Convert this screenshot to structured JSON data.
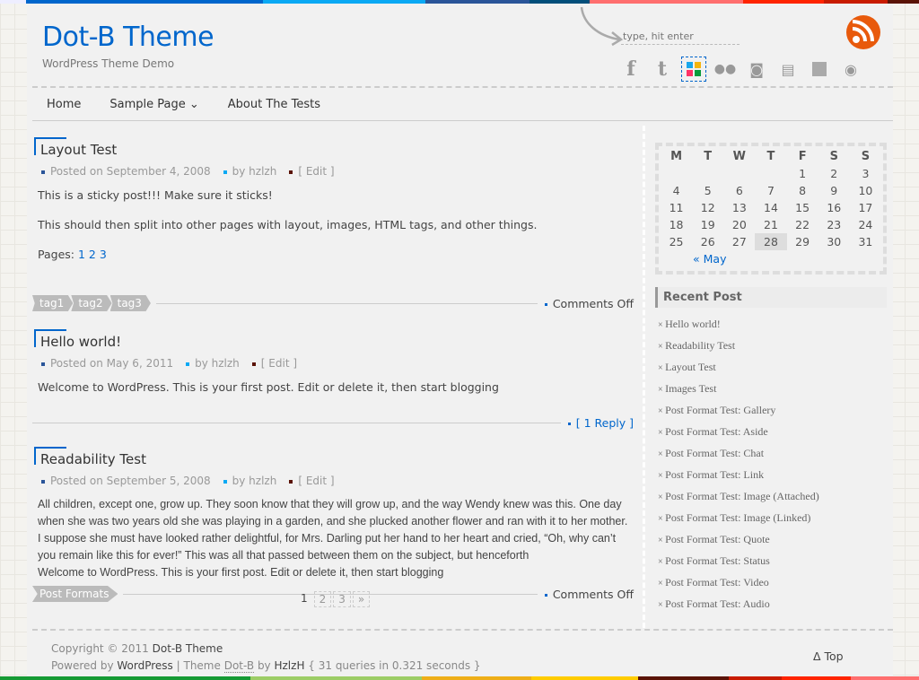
{
  "colors": {
    "top_bar": [
      "#eef",
      "#0066cc",
      "#0aa9f4",
      "#2a5599",
      "#024e7a",
      "#ff6f6f",
      "#ff2400",
      "#c81b00",
      "#5a1306"
    ],
    "bottom_bar": [
      "#159a34",
      "#9ccd66",
      "#eeae18",
      "#ffcc00",
      "#5a1306",
      "#c81b00",
      "#ff2400",
      "#ff6f6f"
    ],
    "accent": "#0066cc"
  },
  "header": {
    "title": "Dot-B Theme",
    "description": "WordPress Theme Demo",
    "search_placeholder": "type, hit enter",
    "social_icons": [
      "facebook-icon",
      "twitter-icon",
      "windows-icon",
      "flickr-icon",
      "qzone-icon",
      "douban-icon",
      "gallery-icon",
      "picasa-icon"
    ]
  },
  "nav": [
    {
      "label": "Home"
    },
    {
      "label": "Sample Page ⌄"
    },
    {
      "label": "About The Tests"
    }
  ],
  "posts": [
    {
      "title": "Layout Test",
      "date": "Posted on September 4, 2008",
      "author": "by hzlzh",
      "edit": "[ Edit ]",
      "paragraphs": [
        "This is a sticky post!!! Make sure it sticks!",
        "This should then split into other pages with layout, images, HTML tags, and other things."
      ],
      "pages_label": "Pages:",
      "pages": [
        "1",
        "2",
        "3"
      ],
      "tags": [
        "tag1",
        "tag2",
        "tag3"
      ],
      "comments": "Comments Off"
    },
    {
      "title": "Hello world!",
      "date": "Posted on May 6, 2011",
      "author": "by hzlzh",
      "edit": "[ Edit ]",
      "paragraphs": [
        "Welcome to WordPress. This is your first post. Edit or delete it, then start blogging"
      ],
      "comments": "[ 1 Reply ]"
    },
    {
      "title": "Readability Test",
      "date": "Posted on September 5, 2008",
      "author": "by hzlzh",
      "edit": "[ Edit ]",
      "paragraphs": [
        "All children, except one, grow up. They soon know that they will grow up, and the way Wendy knew was this. One day when she was two years old she was playing in a garden, and she plucked another flower and ran with it to her mother. I suppose she must have looked rather delightful, for Mrs. Darling put her hand to her heart and cried, “Oh, why can’t you remain like this for ever!” This was all that passed between them on the subject, but henceforth",
        "Welcome to WordPress. This is your first post. Edit or delete it, then start blogging"
      ],
      "tags": [
        "Post Formats"
      ],
      "comments": "Comments Off"
    }
  ],
  "pagination": [
    "1",
    "2",
    "3",
    "»"
  ],
  "calendar": {
    "headers": [
      "M",
      "T",
      "W",
      "T",
      "F",
      "S",
      "S"
    ],
    "rows": [
      [
        "",
        "",
        "",
        "",
        "1",
        "2",
        "3"
      ],
      [
        "4",
        "5",
        "6",
        "7",
        "8",
        "9",
        "10"
      ],
      [
        "11",
        "12",
        "13",
        "14",
        "15",
        "16",
        "17"
      ],
      [
        "18",
        "19",
        "20",
        "21",
        "22",
        "23",
        "24"
      ],
      [
        "25",
        "26",
        "27",
        "28",
        "29",
        "30",
        "31"
      ]
    ],
    "today": "28",
    "prev": "« May"
  },
  "recent": {
    "title": "Recent Post",
    "items": [
      "Hello world!",
      "Readability Test",
      "Layout Test",
      "Images Test",
      "Post Format Test: Gallery",
      "Post Format Test: Aside",
      "Post Format Test: Chat",
      "Post Format Test: Link",
      "Post Format Test: Image (Attached)",
      "Post Format Test: Image (Linked)",
      "Post Format Test: Quote",
      "Post Format Test: Status",
      "Post Format Test: Video",
      "Post Format Test: Audio"
    ]
  },
  "footer": {
    "copyright": "Copyright © 2011 ",
    "site": "Dot-B Theme",
    "powered": "Powered by ",
    "wp": "WordPress",
    "theme": " | Theme ",
    "theme_name": "Dot-B",
    "by": " by ",
    "author": "HzlzH",
    "queries": " { 31 queries in 0.321 seconds }",
    "top": "Δ Top"
  }
}
